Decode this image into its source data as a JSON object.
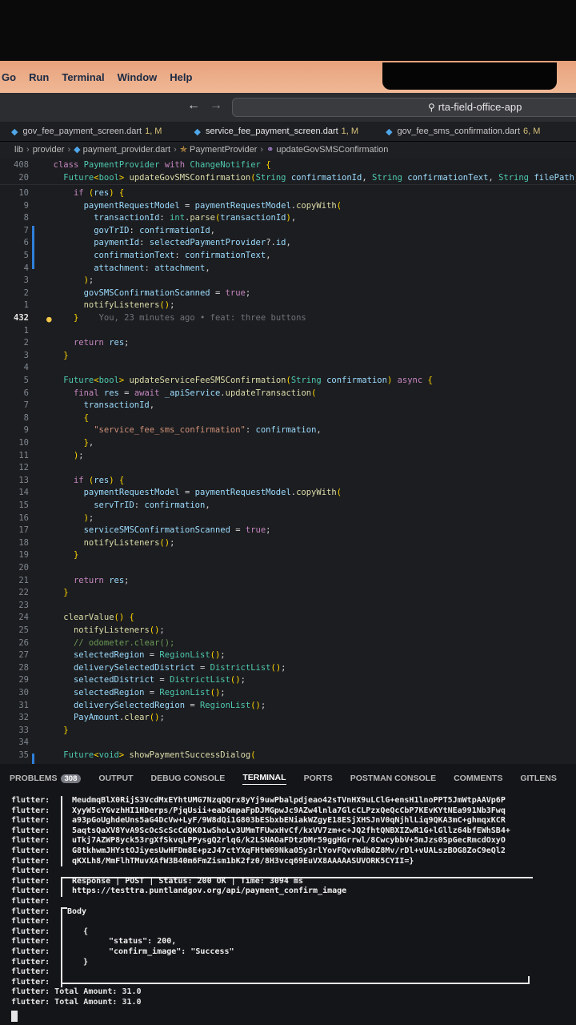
{
  "menubar": {
    "items": [
      "Go",
      "Run",
      "Terminal",
      "Window",
      "Help"
    ]
  },
  "titlebar": {
    "search_text": "rta-field-office-app",
    "back_icon": "arrow-left-icon",
    "forward_icon": "arrow-right-icon"
  },
  "tabs": [
    {
      "name": "gov_fee_payment_screen.dart",
      "badge": "1, M"
    },
    {
      "name": "service_fee_payment_screen.dart",
      "badge": "1, M"
    },
    {
      "name": "gov_fee_sms_confirmation.dart",
      "badge": "6, M"
    }
  ],
  "breadcrumb": [
    "lib",
    "provider",
    "payment_provider.dart",
    "PaymentProvider",
    "updateGovSMSConfirmation"
  ],
  "editor": {
    "sticky": [
      {
        "num": "408",
        "text": "  class PaymentProvider with ChangeNotifier {"
      },
      {
        "num": "20",
        "text": "    Future<bool> updateGovSMSConfirmation(String confirmationId, String confirmationText, String filePath) async {"
      }
    ],
    "lines": [
      {
        "num": "10",
        "text": "      if (res) {"
      },
      {
        "num": "9",
        "text": "        paymentRequestModel = paymentRequestModel.copyWith("
      },
      {
        "num": "8",
        "text": "          transactionId: int.parse(transactionId),"
      },
      {
        "num": "7",
        "text": "          govTrID: confirmationId,"
      },
      {
        "num": "6",
        "text": "          paymentId: selectedPaymentProvider?.id,"
      },
      {
        "num": "5",
        "text": "          confirmationText: confirmationText,"
      },
      {
        "num": "4",
        "text": "          attachment: attachment,"
      },
      {
        "num": "3",
        "text": "        );"
      },
      {
        "num": "2",
        "text": "        govSMSConfirmationScanned = true;"
      },
      {
        "num": "1",
        "text": "        notifyListeners();"
      },
      {
        "num": "432",
        "text": "      }",
        "blame": "You, 23 minutes ago • feat: three buttons",
        "current": true
      },
      {
        "num": "1",
        "text": ""
      },
      {
        "num": "2",
        "text": "      return res;"
      },
      {
        "num": "3",
        "text": "    }"
      },
      {
        "num": "4",
        "text": ""
      },
      {
        "num": "5",
        "text": "    Future<bool> updateServiceFeeSMSConfirmation(String confirmation) async {"
      },
      {
        "num": "6",
        "text": "      final res = await _apiService.updateTransaction("
      },
      {
        "num": "7",
        "text": "        transactionId,"
      },
      {
        "num": "8",
        "text": "        {"
      },
      {
        "num": "9",
        "text": "          \"service_fee_sms_confirmation\": confirmation,"
      },
      {
        "num": "10",
        "text": "        },"
      },
      {
        "num": "11",
        "text": "      );"
      },
      {
        "num": "12",
        "text": ""
      },
      {
        "num": "13",
        "text": "      if (res) {"
      },
      {
        "num": "14",
        "text": "        paymentRequestModel = paymentRequestModel.copyWith("
      },
      {
        "num": "15",
        "text": "          servTrID: confirmation,"
      },
      {
        "num": "16",
        "text": "        );"
      },
      {
        "num": "17",
        "text": "        serviceSMSConfirmationScanned = true;"
      },
      {
        "num": "18",
        "text": "        notifyListeners();"
      },
      {
        "num": "19",
        "text": "      }"
      },
      {
        "num": "20",
        "text": ""
      },
      {
        "num": "21",
        "text": "      return res;"
      },
      {
        "num": "22",
        "text": "    }"
      },
      {
        "num": "23",
        "text": ""
      },
      {
        "num": "24",
        "text": "    clearValue() {"
      },
      {
        "num": "25",
        "text": "      notifyListeners();"
      },
      {
        "num": "26",
        "text": "      // odometer.clear();"
      },
      {
        "num": "27",
        "text": "      selectedRegion = RegionList();"
      },
      {
        "num": "28",
        "text": "      deliverySelectedDistrict = DistrictList();"
      },
      {
        "num": "29",
        "text": "      selectedDistrict = DistrictList();"
      },
      {
        "num": "30",
        "text": "      selectedRegion = RegionList();"
      },
      {
        "num": "31",
        "text": "      deliverySelectedRegion = RegionList();"
      },
      {
        "num": "32",
        "text": "      PayAmount.clear();"
      },
      {
        "num": "33",
        "text": "    }"
      },
      {
        "num": "34",
        "text": ""
      },
      {
        "num": "35",
        "text": "    Future<void> showPaymentSuccessDialog("
      }
    ]
  },
  "panel": {
    "tabs": [
      {
        "label": "PROBLEMS",
        "count": "308"
      },
      {
        "label": "OUTPUT"
      },
      {
        "label": "DEBUG CONSOLE"
      },
      {
        "label": "TERMINAL",
        "active": true
      },
      {
        "label": "PORTS"
      },
      {
        "label": "POSTMAN CONSOLE"
      },
      {
        "label": "COMMENTS"
      },
      {
        "label": "GITLENS"
      }
    ],
    "prefix": "flutter:",
    "base64_lines": [
      "MeudmqBlX0RijS3VcdMxEYhtUMG7NzqQQrx8yYj9uwPbalpdjeao42sTVnHX9uLClG+ensH1lnoPPT5JmWtpAAVp6P",
      "XyyW5cYGvzhHI1HDerps/PjqUsii+eaDGmpaFpDJMGpwJc9AZw4lnla7GlcCLPzxQeQcCbP7KEvKYtNEa991Nb3Fwq",
      "a93pGoUghdeUns5aG4DcVw+LyF/9W8dQi1G803bESbxbENiakWZgyE18ESjXHSJnV0qNjhlLiq9QKA3mC+ghmqxKCR",
      "5aqtsQaXV8YvA9ScOcScScCdQK01wShoLv3UMmTFUwxHvCf/kxVV7zm+c+JQ2fhtQNBXIZwR1G+lGllz64bfEWhSB4+",
      "uTkj7AZWP8yck53rgXfSkvqLPPysgQ2rlqG/k2LSNAOaFDtzDMr59ggHGrrwl/8CwcybbV+5mJzs0SpGecRmcdOxyO",
      "G8tkhwmJHYstOJiyesUwHFDm8E+pzJ47ctYXqFHtW69Nka05y3rlYovFQvvRdb0Z8Mv/rDl+vUALszBOG8ZoC9eQl2",
      "qKXLh8/MmFlhTMuvXAfW3B40m6FmZism1bK2fz0/8H3vcq69EuVX8AAAAASUVORK5CYII=}"
    ],
    "response": {
      "label": "Response",
      "method": "POST",
      "status": "Status: 200 OK",
      "time": "Time: 3094 ms",
      "url": "https://testtra.puntlandgov.org/api/payment_confirm_image"
    },
    "body": {
      "label": "Body",
      "open": "{",
      "line1": "\"status\": 200,",
      "line2": "\"confirm_image\": \"Success\"",
      "close": "}"
    },
    "totals": [
      "flutter: Total Amount: 31.0",
      "flutter: Total Amount: 31.0"
    ]
  }
}
